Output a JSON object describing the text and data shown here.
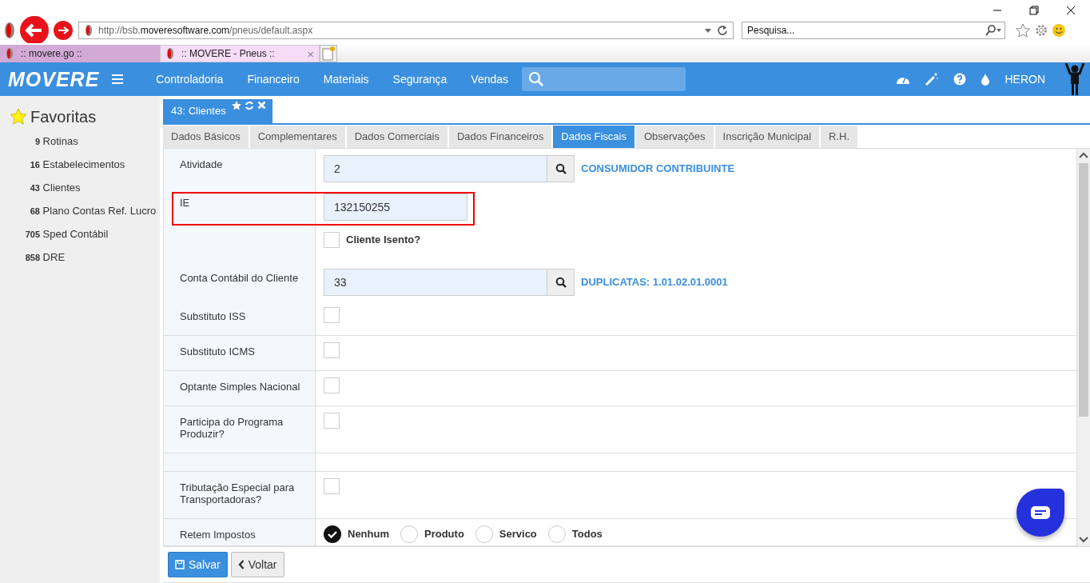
{
  "browser": {
    "address": {
      "prefix": "http://bsb.",
      "domain": "moveresoftware.com",
      "path": "/pneus/default.aspx"
    },
    "search": {
      "placeholder": "Pesquisa..."
    },
    "tabs": [
      {
        "label": ":: movere.go ::",
        "selected": false
      },
      {
        "label": ":: MOVERE - Pneus ::",
        "selected": true,
        "close": "×"
      }
    ]
  },
  "navbar": {
    "logo": "MOVERE",
    "menu": [
      "Controladoria",
      "Financeiro",
      "Materiais",
      "Segurança",
      "Vendas"
    ],
    "user": "HERON"
  },
  "sidebar": {
    "title": "Favoritas",
    "items": [
      {
        "number": "9",
        "label": "Rotinas"
      },
      {
        "number": "16",
        "label": "Estabelecimentos"
      },
      {
        "number": "43",
        "label": "Clientes"
      },
      {
        "number": "68",
        "label": "Plano Contas Ref. Lucro"
      },
      {
        "number": "705",
        "label": "Sped Contábil"
      },
      {
        "number": "858",
        "label": "DRE"
      }
    ]
  },
  "window_tab": {
    "label": "43: Clientes"
  },
  "tabs": [
    {
      "label": "Dados Básicos",
      "selected": false
    },
    {
      "label": "Complementares",
      "selected": false
    },
    {
      "label": "Dados Comerciais",
      "selected": false
    },
    {
      "label": "Dados Financeiros",
      "selected": false
    },
    {
      "label": "Dados Fiscais",
      "selected": true
    },
    {
      "label": "Observações",
      "selected": false
    },
    {
      "label": "Inscrição Municipal",
      "selected": false
    },
    {
      "label": "R.H.",
      "selected": false
    }
  ],
  "fields": [
    {
      "kind": "lookup",
      "label": "Atividade",
      "value": "2",
      "description": "CONSUMIDOR CONTRIBUINTE"
    },
    {
      "kind": "text",
      "label": "IE",
      "value": "132150255",
      "highlighted": true
    },
    {
      "kind": "checkbox_labeled",
      "checkbox_label": "Cliente Isento?",
      "checked": false
    },
    {
      "kind": "lookup",
      "label": "Conta Contábil do Cliente",
      "value": "33",
      "description": "DUPLICATAS: 1.01.02.01.0001"
    },
    {
      "kind": "checkbox",
      "label": "Substituto ISS",
      "checked": false
    },
    {
      "kind": "checkbox",
      "label": "Substituto ICMS",
      "checked": false
    },
    {
      "kind": "checkbox",
      "label": "Optante Simples Nacional",
      "checked": false
    },
    {
      "kind": "checkbox",
      "label": "Participa do Programa Produzir?",
      "checked": false
    },
    {
      "kind": "blank"
    },
    {
      "kind": "checkbox",
      "label": "Tributação Especial para Transportadoras?",
      "checked": false
    },
    {
      "kind": "radio",
      "label": "Retem Impostos",
      "options": [
        {
          "label": "Nenhum",
          "selected": true
        },
        {
          "label": "Produto",
          "selected": false
        },
        {
          "label": "Servico",
          "selected": false
        },
        {
          "label": "Todos",
          "selected": false
        }
      ]
    }
  ],
  "buttons": [
    {
      "kind": "primary",
      "label": "Salvar"
    },
    {
      "kind": "default",
      "label": "Voltar"
    }
  ]
}
